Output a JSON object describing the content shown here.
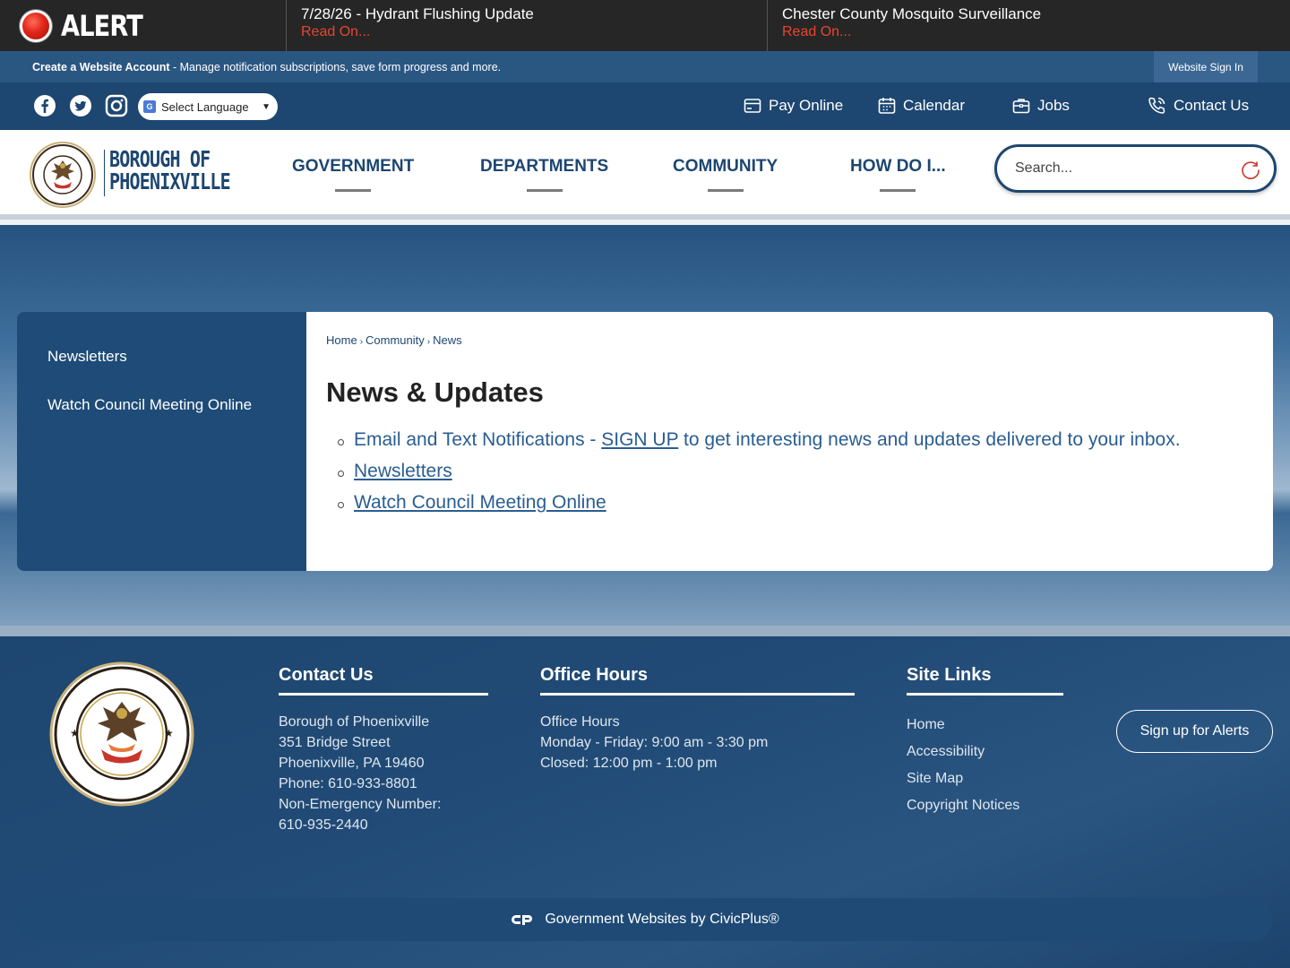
{
  "alert": {
    "label": "ALERT",
    "items": [
      {
        "title": "7/28/26 - Hydrant Flushing Update",
        "read_more": "Read On..."
      },
      {
        "title": "Chester County Mosquito Surveillance",
        "read_more": "Read On..."
      }
    ]
  },
  "account_bar": {
    "create_account": "Create a Website Account",
    "description": " - Manage notification subscriptions, save form progress and more.",
    "sign_in": "Website Sign In"
  },
  "utility": {
    "social": [
      "facebook-icon",
      "twitter-icon",
      "instagram-icon"
    ],
    "language": "Select Language",
    "links": [
      {
        "label": "Pay Online",
        "icon": "card-icon"
      },
      {
        "label": "Calendar",
        "icon": "calendar-icon"
      },
      {
        "label": "Jobs",
        "icon": "briefcase-icon"
      },
      {
        "label": "Contact Us",
        "icon": "phone-icon"
      }
    ]
  },
  "header": {
    "logo_line1": "BOROUGH OF",
    "logo_line2": "PHOENIXVILLE",
    "nav": [
      "GOVERNMENT",
      "DEPARTMENTS",
      "COMMUNITY",
      "HOW DO I..."
    ],
    "search_placeholder": "Search..."
  },
  "sidebar": {
    "items": [
      "Newsletters",
      "Watch Council Meeting Online"
    ]
  },
  "content": {
    "breadcrumb": [
      "Home",
      "Community",
      "News"
    ],
    "title": "News & Updates",
    "list": {
      "item1_prefix": "Email and Text Notifications - ",
      "item1_link": "SIGN UP",
      "item1_suffix": " to get interesting news and updates delivered to your inbox.",
      "item2": "Newsletters",
      "item3": "Watch Council Meeting Online"
    }
  },
  "footer": {
    "contact": {
      "heading": "Contact Us",
      "lines": [
        "Borough of Phoenixville",
        "351 Bridge Street",
        "Phoenixville, PA 19460",
        "Phone: 610-933-8801",
        "Non-Emergency Number:",
        "610-935-2440"
      ]
    },
    "hours": {
      "heading": "Office Hours",
      "lines": [
        "Office Hours",
        "Monday - Friday: 9:00 am - 3:30 pm",
        "Closed: 12:00 pm - 1:00 pm"
      ]
    },
    "site_links": {
      "heading": "Site Links",
      "links": [
        "Home",
        "Accessibility",
        "Site Map",
        "Copyright Notices"
      ]
    },
    "alerts_button": "Sign up for Alerts",
    "civicplus": "Government Websites by CivicPlus®"
  },
  "colors": {
    "primary": "#1d4670",
    "alert_bg": "#262626",
    "alert_read": "#e8452f",
    "link": "#2a5d91"
  }
}
